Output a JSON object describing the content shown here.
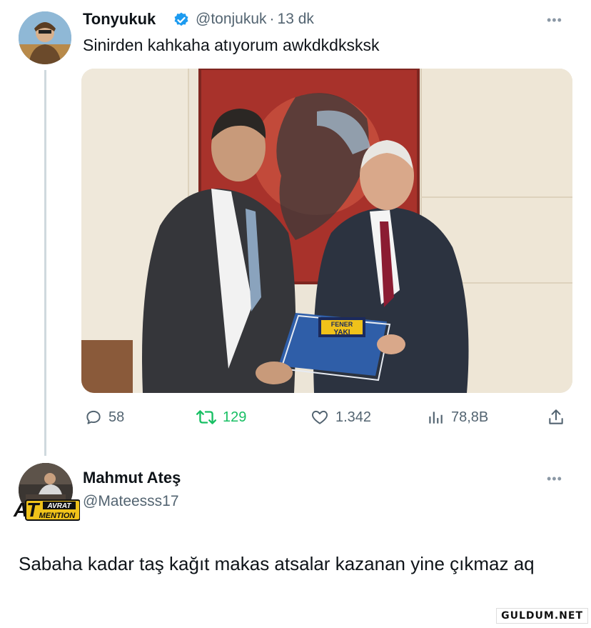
{
  "tweet": {
    "author_name": "Tonyukuk",
    "handle": "@tonjukuk",
    "separator": "·",
    "time": "13 dk",
    "text": "Sinirden kahkaha atıyorum awkdkdksksk",
    "verified": true,
    "more_icon": "more-icon",
    "media": {
      "description_none": "",
      "folder_label_top": "FENER",
      "folder_label_bottom": "YAKI"
    },
    "stats": {
      "replies": "58",
      "retweets": "129",
      "likes": "1.342",
      "views": "78,8B"
    }
  },
  "reply": {
    "author_name": "Mahmut Ateş",
    "handle": "@Mateesss17",
    "text": "Sabaha kadar taş kağıt makas atsalar kazanan yine çıkmaz aq",
    "avatar_badge_big": "AT",
    "avatar_badge_small_top": "AVRAT",
    "avatar_badge_small_bottom": "MENTION"
  },
  "watermark": "GULDUM.NET",
  "colors": {
    "accent": "#1d9bf0",
    "retweet": "#17bf63",
    "muted": "#536471"
  }
}
